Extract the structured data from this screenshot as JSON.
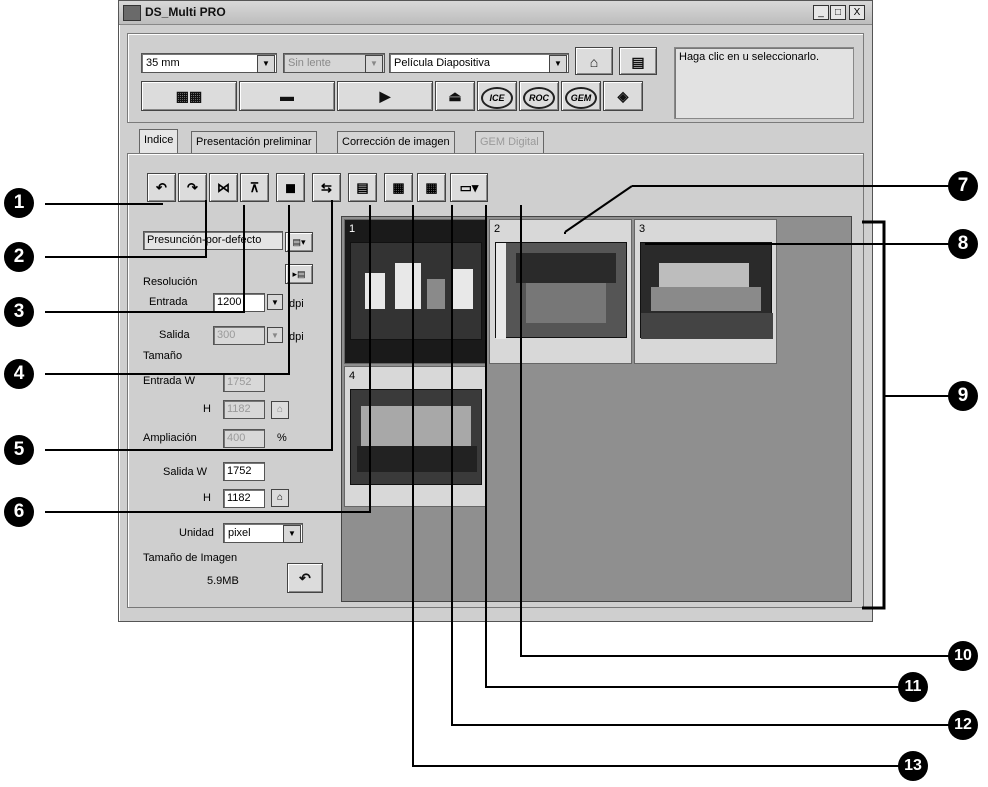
{
  "window": {
    "title": "DS_Multi PRO",
    "controls": {
      "minimize": "_",
      "maximize": "□",
      "close": "X"
    }
  },
  "toolbar": {
    "film_format": "35 mm",
    "lens": "Sin lente",
    "film_type": "Película Diapositiva",
    "buttons": [
      "index-scan",
      "prescan",
      "scan",
      "eject",
      "ICE",
      "ROC",
      "GEM",
      "help"
    ],
    "help_text": "Haga clic en u seleccionarlo."
  },
  "tabs": [
    {
      "label": "Indice",
      "state": "active"
    },
    {
      "label": "Presentación preliminar",
      "state": "normal"
    },
    {
      "label": "Corrección de imagen",
      "state": "normal"
    },
    {
      "label": "GEM Digital",
      "state": "disabled"
    }
  ],
  "icon_toolbar": [
    "rotate-left",
    "rotate-right",
    "flip-horizontal",
    "flip-vertical",
    "negative-positive",
    "swap",
    "select-frame",
    "select-all",
    "clear-selection",
    "display-settings"
  ],
  "settings": {
    "preset": "Presunción-por-defecto",
    "resolution_label": "Resolución",
    "input_label": "Entrada",
    "input_value": "1200",
    "dpi": "dpi",
    "output_label": "Salida",
    "output_value": "300",
    "size_label": "Tamaño",
    "input_w_label": "Entrada W",
    "input_w_value": "1752",
    "h_label": "H",
    "input_h_value": "1182",
    "magnification_label": "Ampliación",
    "magnification_value": "400",
    "percent": "%",
    "output_w_label": "Salida W",
    "output_w_value": "1752",
    "output_h_value": "1182",
    "unit_label": "Unidad",
    "unit_value": "pixel",
    "image_size_label": "Tamaño de Imagen",
    "image_size_value": "5.9MB"
  },
  "thumbnails": [
    {
      "number": "1",
      "selected": true
    },
    {
      "number": "2",
      "selected": false
    },
    {
      "number": "3",
      "selected": false
    },
    {
      "number": "4",
      "selected": false
    }
  ],
  "callouts": [
    "1",
    "2",
    "3",
    "4",
    "5",
    "6",
    "7",
    "8",
    "9",
    "10",
    "11",
    "12",
    "13"
  ],
  "colors": {
    "window_bg": "#cfcfcf",
    "thumb_area_bg": "#8f8f8f",
    "callout": "#000000"
  }
}
